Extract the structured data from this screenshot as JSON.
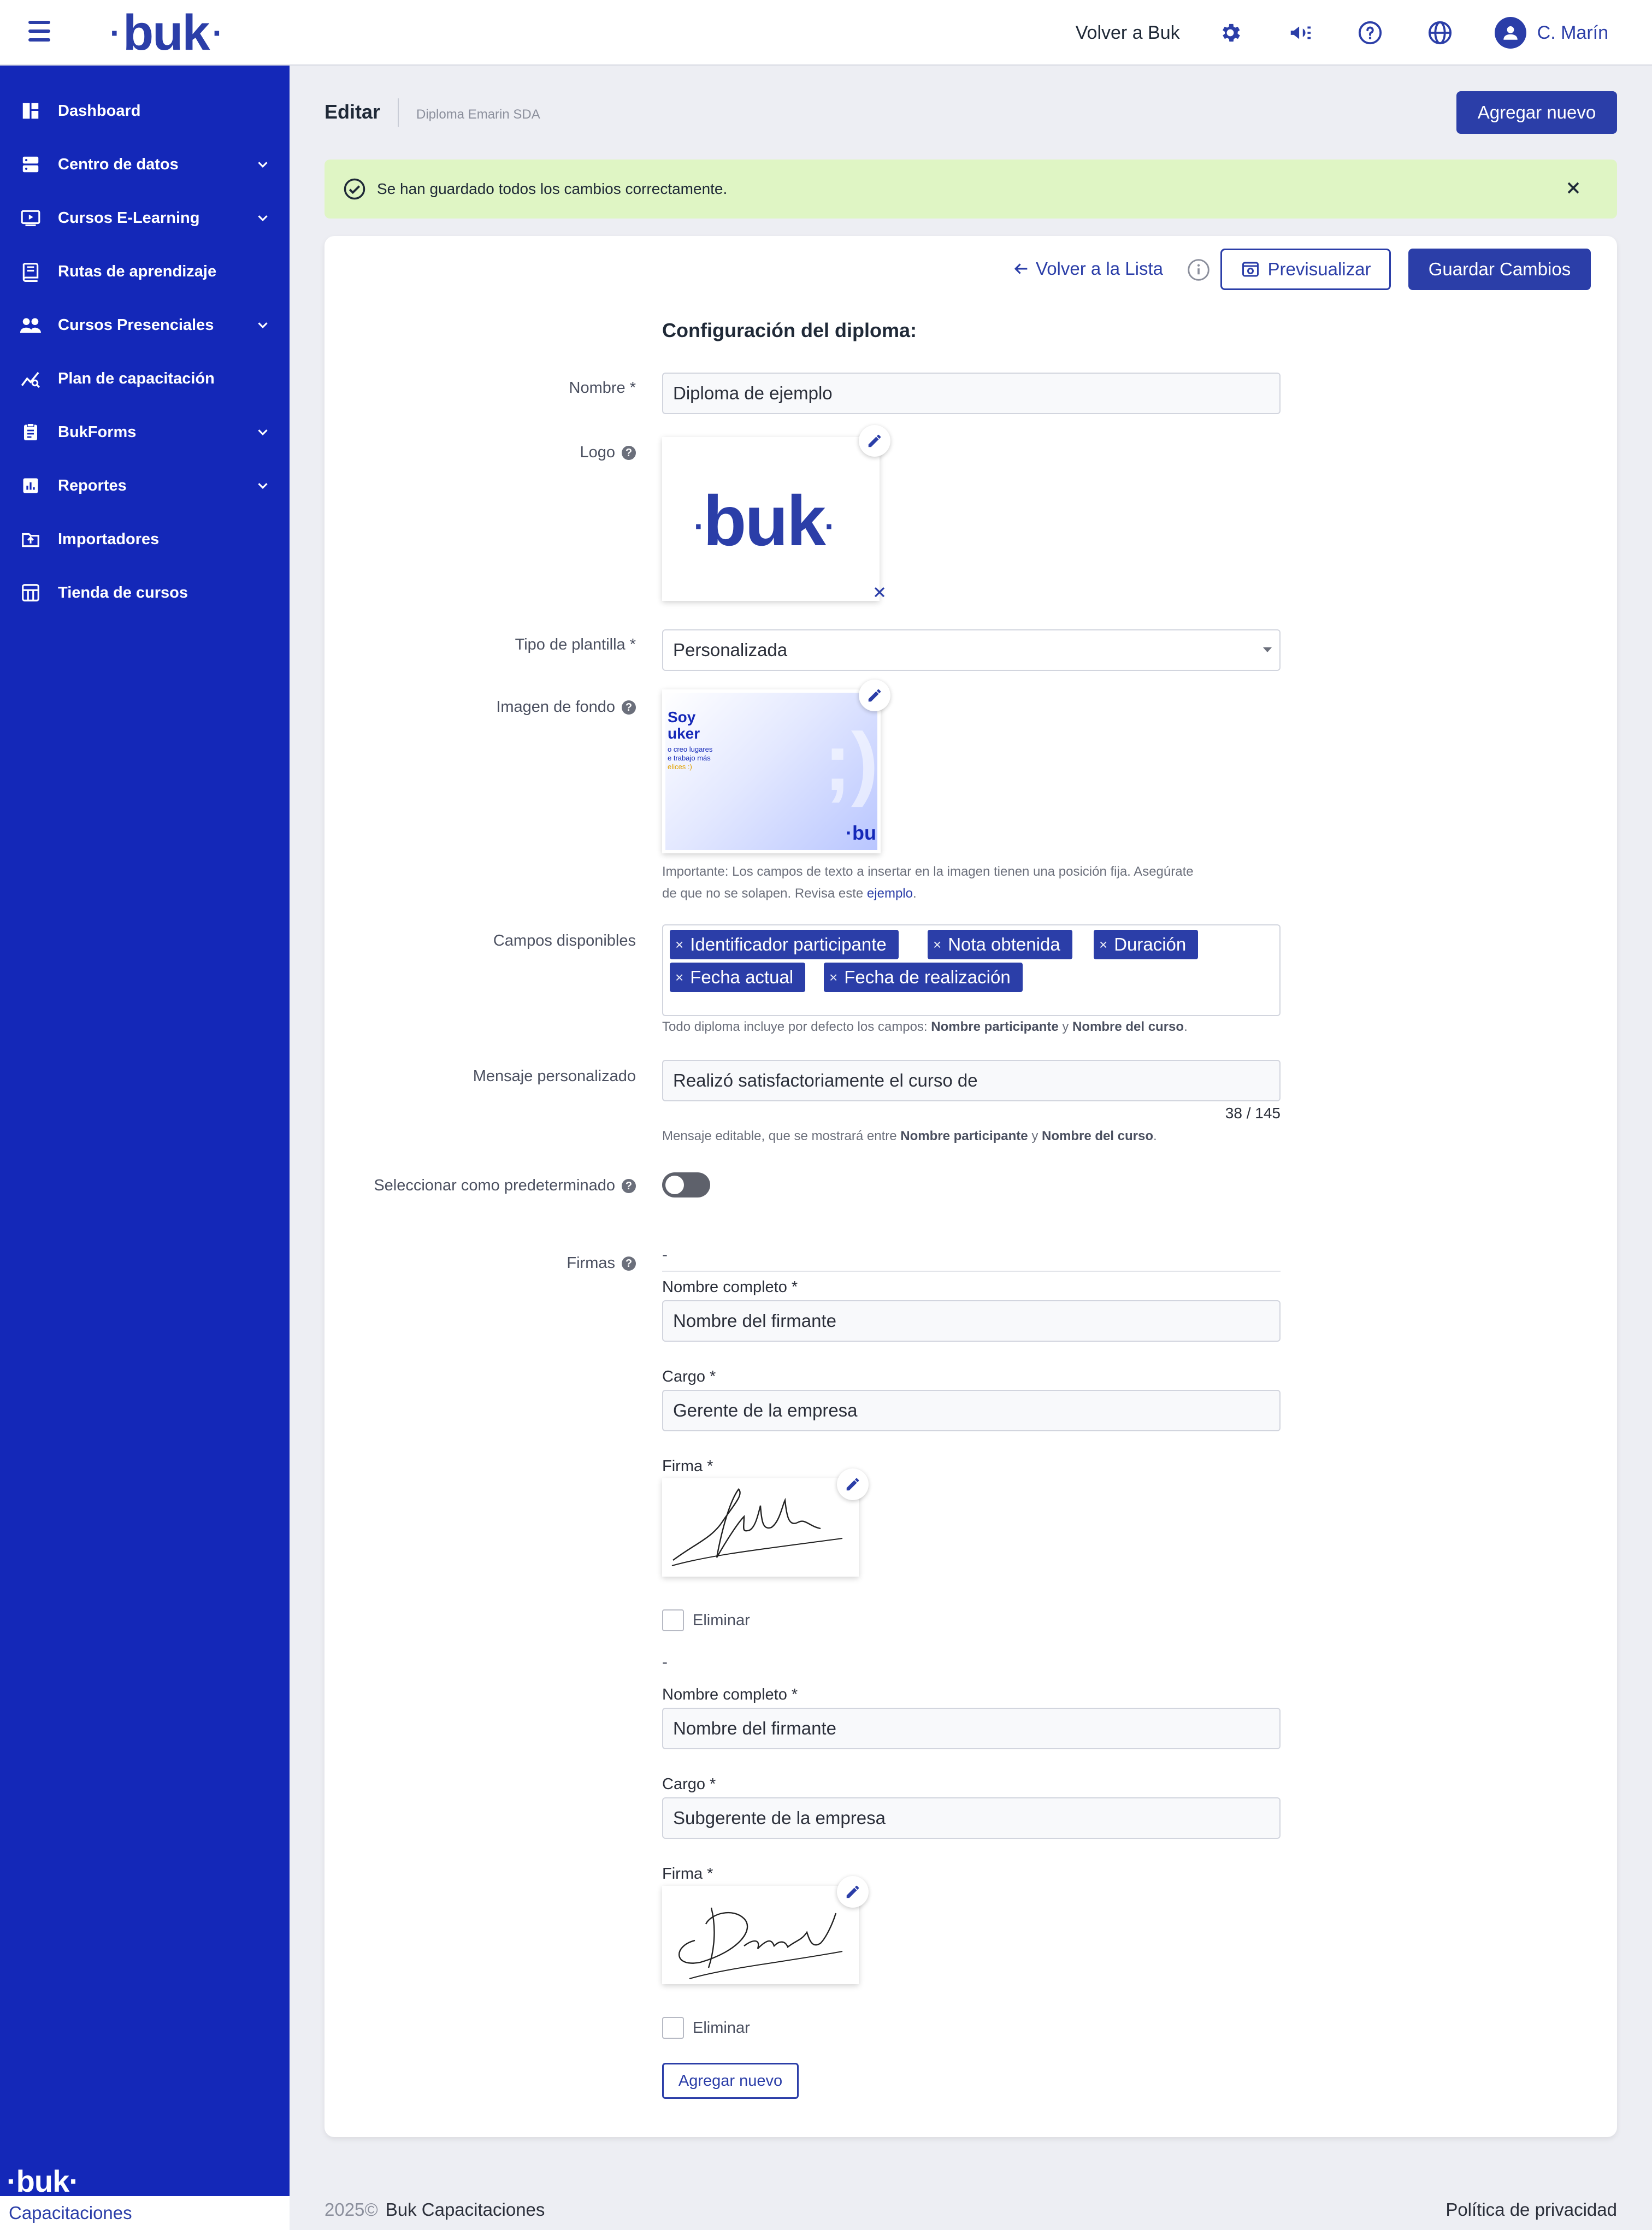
{
  "topbar": {
    "logo": "buk",
    "back_link": "Volver a Buk",
    "user_name": "C. Marín",
    "icons": [
      "gear-icon",
      "megaphone-icon",
      "help-icon",
      "globe-icon",
      "user-icon"
    ]
  },
  "sidebar": {
    "items": [
      {
        "label": "Dashboard",
        "icon": "dashboard-icon",
        "expandable": false
      },
      {
        "label": "Centro de datos",
        "icon": "database-icon",
        "expandable": true
      },
      {
        "label": "Cursos E-Learning",
        "icon": "video-icon",
        "expandable": true
      },
      {
        "label": "Rutas de aprendizaje",
        "icon": "book-icon",
        "expandable": false
      },
      {
        "label": "Cursos Presenciales",
        "icon": "people-icon",
        "expandable": true
      },
      {
        "label": "Plan de capacitación",
        "icon": "trend-icon",
        "expandable": false
      },
      {
        "label": "BukForms",
        "icon": "clipboard-icon",
        "expandable": true
      },
      {
        "label": "Reportes",
        "icon": "chart-icon",
        "expandable": true
      },
      {
        "label": "Importadores",
        "icon": "upload-icon",
        "expandable": false
      },
      {
        "label": "Tienda de cursos",
        "icon": "store-icon",
        "expandable": false
      }
    ],
    "logo": "buk",
    "footer": "Capacitaciones"
  },
  "header": {
    "title": "Editar",
    "breadcrumb": "Diploma Emarin SDA",
    "add_button": "Agregar nuevo"
  },
  "alert": {
    "message": "Se han guardado todos los cambios correctamente."
  },
  "toolbar": {
    "back": "Volver a la Lista",
    "preview": "Previsualizar",
    "save": "Guardar Cambios"
  },
  "form": {
    "section_title": "Configuración del diploma:",
    "nombre_label": "Nombre *",
    "nombre_value": "Diploma de ejemplo",
    "logo_label": "Logo",
    "logo_text": "buk",
    "tipo_label": "Tipo de plantilla *",
    "tipo_value": "Personalizada",
    "fondo_label": "Imagen de fondo",
    "fondo_thumb": {
      "line1": "Soy",
      "line2": "uker",
      "line3": "o creo lugares",
      "line4": "e trabajo más",
      "line5": "elices :)",
      "brand": "·bu"
    },
    "fondo_hint_1": "Importante: Los campos de texto a insertar en la imagen tienen una posición fija. Asegúrate",
    "fondo_hint_2": "de que no se solapen. Revisa este",
    "fondo_hint_link": "ejemplo",
    "campos_label": "Campos disponibles",
    "campos": [
      "Identificador participante",
      "Nota obtenida",
      "Duración",
      "Fecha actual",
      "Fecha de realización"
    ],
    "campos_hint_pre": "Todo diploma incluye por defecto los campos:",
    "campos_hint_b1": "Nombre participante",
    "campos_hint_mid": "y",
    "campos_hint_b2": "Nombre del curso",
    "mensaje_label": "Mensaje personalizado",
    "mensaje_value": "Realizó satisfactoriamente el curso de",
    "mensaje_counter": "38 / 145",
    "mensaje_hint_pre": "Mensaje editable, que se mostrará entre",
    "mensaje_hint_b1": "Nombre participante",
    "mensaje_hint_mid": "y",
    "mensaje_hint_b2": "Nombre del curso",
    "predeterminado_label": "Seleccionar como predeterminado",
    "predeterminado_value": false,
    "firmas_label": "Firmas",
    "firmas": [
      {
        "dash": "-",
        "nombre_label": "Nombre completo *",
        "nombre_placeholder": "Nombre del firmante",
        "cargo_label": "Cargo *",
        "cargo_value": "Gerente de la empresa",
        "firma_label": "Firma *",
        "eliminar_label": "Eliminar"
      },
      {
        "dash": "-",
        "nombre_label": "Nombre completo *",
        "nombre_placeholder": "Nombre del firmante",
        "cargo_label": "Cargo *",
        "cargo_value": "Subgerente de la empresa",
        "firma_label": "Firma *",
        "eliminar_label": "Eliminar"
      }
    ],
    "add_firma": "Agregar nuevo"
  },
  "footer": {
    "year": "2025©",
    "product": "Buk Capacitaciones",
    "privacy": "Política de privacidad"
  },
  "colors": {
    "primary": "#2b3ea8",
    "sidebar": "#1428b8",
    "success_bg": "#dff5c4"
  }
}
